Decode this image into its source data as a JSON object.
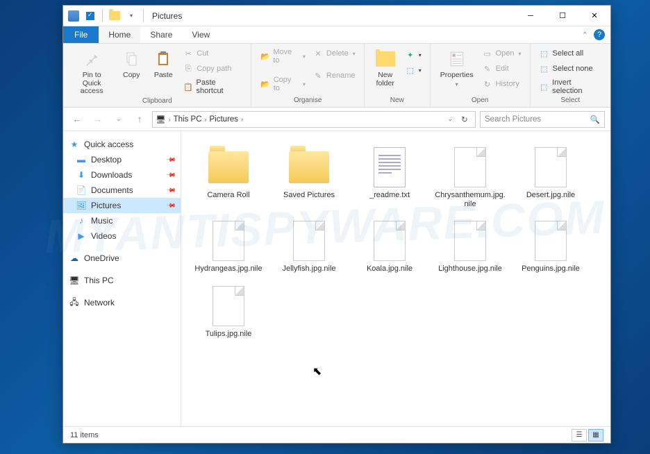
{
  "window_title": "Pictures",
  "menu": {
    "file": "File",
    "home": "Home",
    "share": "Share",
    "view": "View"
  },
  "ribbon": {
    "pin": "Pin to Quick\naccess",
    "copy": "Copy",
    "paste": "Paste",
    "cut": "Cut",
    "copy_path": "Copy path",
    "paste_shortcut": "Paste shortcut",
    "clipboard": "Clipboard",
    "move_to": "Move to",
    "copy_to": "Copy to",
    "delete": "Delete",
    "rename": "Rename",
    "organise": "Organise",
    "new_folder": "New\nfolder",
    "new": "New",
    "properties": "Properties",
    "open": "Open",
    "edit": "Edit",
    "history": "History",
    "open_group": "Open",
    "select_all": "Select all",
    "select_none": "Select none",
    "invert": "Invert selection",
    "select": "Select"
  },
  "breadcrumb": {
    "root": "This PC",
    "current": "Pictures"
  },
  "search_placeholder": "Search Pictures",
  "sidebar": {
    "quick_access": "Quick access",
    "desktop": "Desktop",
    "downloads": "Downloads",
    "documents": "Documents",
    "pictures": "Pictures",
    "music": "Music",
    "videos": "Videos",
    "onedrive": "OneDrive",
    "this_pc": "This PC",
    "network": "Network"
  },
  "files": [
    {
      "name": "Camera Roll",
      "type": "folder"
    },
    {
      "name": "Saved Pictures",
      "type": "folder"
    },
    {
      "name": "_readme.txt",
      "type": "txt"
    },
    {
      "name": "Chrysanthemum.jpg.nile",
      "type": "blank"
    },
    {
      "name": "Desert.jpg.nile",
      "type": "blank"
    },
    {
      "name": "Hydrangeas.jpg.nile",
      "type": "blank"
    },
    {
      "name": "Jellyfish.jpg.nile",
      "type": "blank"
    },
    {
      "name": "Koala.jpg.nile",
      "type": "blank"
    },
    {
      "name": "Lighthouse.jpg.nile",
      "type": "blank"
    },
    {
      "name": "Penguins.jpg.nile",
      "type": "blank"
    },
    {
      "name": "Tulips.jpg.nile",
      "type": "blank"
    }
  ],
  "status": "11 items",
  "watermark": "MYANTISPYWARE.COM",
  "colors": {
    "accent": "#1979ca",
    "folder": "#f5c956",
    "selection": "#cce8ff"
  }
}
